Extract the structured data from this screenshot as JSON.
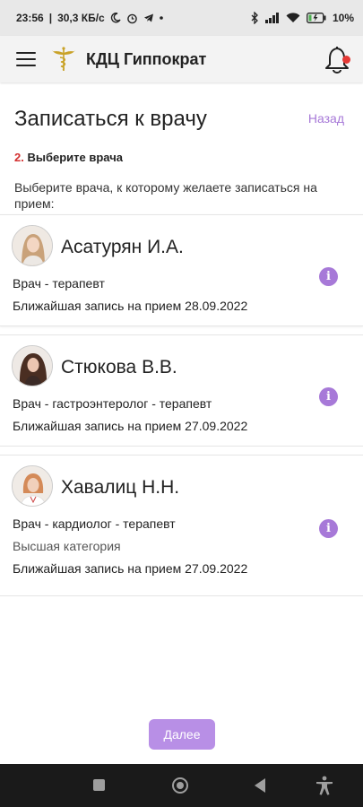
{
  "status_bar": {
    "time": "23:56",
    "speed": "30,3 КБ/с",
    "battery": "10%",
    "icons": [
      "moon-icon",
      "alarm-icon",
      "telegram-icon",
      "dot-icon",
      "bluetooth-icon",
      "signal-icon",
      "wifi-icon",
      "battery-icon"
    ]
  },
  "app_bar": {
    "title": "КДЦ Гиппократ",
    "menu_icon": "hamburger-menu-icon",
    "logo_icon": "caduceus-logo",
    "notifications_icon": "bell-icon"
  },
  "page": {
    "title": "Записаться к врачу",
    "back_label": "Назад",
    "step_number": "2.",
    "step_label": "Выберите врача",
    "hint": "Выберите врача, к которому желаете записаться на прием:"
  },
  "doctors": [
    {
      "name": "Асатурян И.А.",
      "specialty": "Врач - терапевт",
      "nearest": "Ближайшая запись на прием 28.09.2022"
    },
    {
      "name": "Стюкова В.В.",
      "specialty": "Врач - гастроэнтеролог - терапевт",
      "nearest": "Ближайшая запись на прием 27.09.2022"
    },
    {
      "name": "Хавалиц Н.Н.",
      "specialty": "Врач - кардиолог - терапевт",
      "category": "Высшая категория",
      "nearest": "Ближайшая запись на прием 27.09.2022"
    }
  ],
  "info_icon": "i",
  "next_button": "Далее",
  "colors": {
    "accent": "#a779d8",
    "next_button": "#b88fe6",
    "step_number": "#d32f2f",
    "notification_dot": "#e53935"
  }
}
